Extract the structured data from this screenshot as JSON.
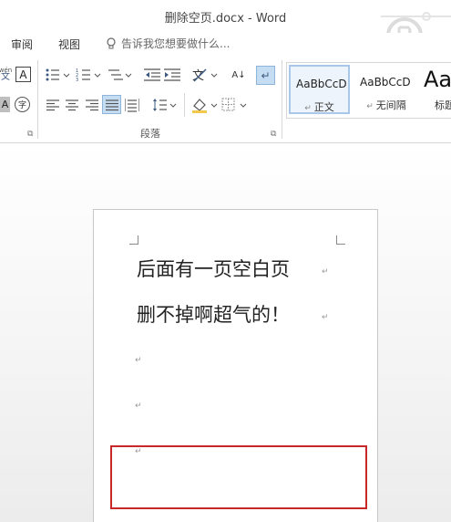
{
  "window": {
    "title": "删除空页.docx - Word"
  },
  "tabs": [
    "审阅",
    "视图"
  ],
  "tell_me": {
    "text": "告诉我您想要做什么..."
  },
  "ribbon": {
    "font_small": {
      "pinyin": "wén",
      "char": "文",
      "a_label": "A",
      "a_gray": "A",
      "circle_char": "字"
    },
    "paragraph_group_label": "段落",
    "sort_label": "A↓",
    "styles": [
      {
        "preview": "AaBbCcD",
        "name": "正文"
      },
      {
        "preview": "AaBbCcD",
        "name": "无间隔"
      },
      {
        "preview": "Aa",
        "name": "标题"
      }
    ]
  },
  "document": {
    "lines": [
      "后面有一页空白页",
      "删不掉啊超气的！"
    ],
    "paragraph_mark": "↵"
  }
}
